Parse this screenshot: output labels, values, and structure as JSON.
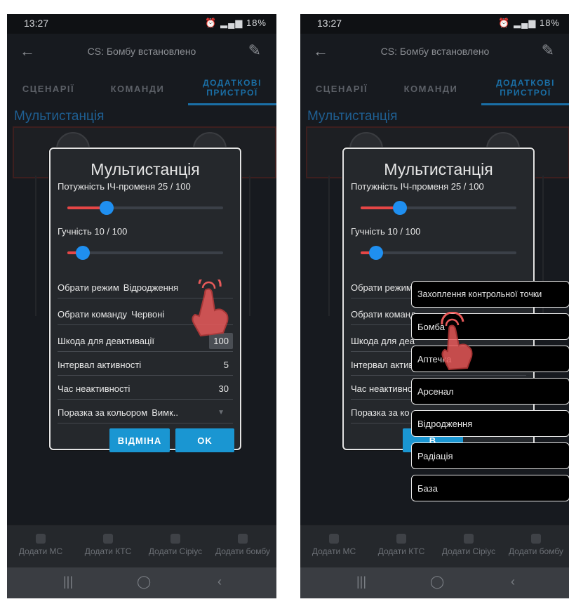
{
  "left": {
    "status": {
      "time": "13:27",
      "battery": "18%"
    },
    "appbar": {
      "title": "CS: Бомбу встановлено"
    },
    "tabs": [
      "СЦЕНАРІЇ",
      "КОМАНДИ",
      "ДОДАТКОВІ ПРИСТРОЇ"
    ],
    "section_title": "Мультистанція",
    "dialog": {
      "title": "Мультистанція",
      "ir_label": "Потужність ІЧ-променя 25 / 100",
      "ir_value": 25,
      "volume_label": "Гучність 10 / 100",
      "volume_value": 10,
      "mode_label": "Обрати режим",
      "mode_value": "Відродження",
      "team_label": "Обрати команду",
      "team_value": "Червоні",
      "damage_label": "Шкода для деактивації",
      "damage_value": "100",
      "interval_label": "Інтервал активності",
      "interval_value": "5",
      "inactive_label": "Час неактивності",
      "inactive_value": "30",
      "color_defeat_label": "Поразка за кольором",
      "color_defeat_value": "Вимк..",
      "cancel": "ВІДМІНА",
      "ok": "OK"
    },
    "bottomnav": [
      "Додати МС",
      "Додати КТС",
      "Додати Сіріус",
      "Додати бомбу"
    ]
  },
  "right": {
    "status": {
      "time": "13:27",
      "battery": "18%"
    },
    "appbar": {
      "title": "CS: Бомбу встановлено"
    },
    "tabs": [
      "СЦЕНАРІЇ",
      "КОМАНДИ",
      "ДОДАТКОВІ ПРИСТРОЇ"
    ],
    "section_title": "Мультистанція",
    "dialog": {
      "title": "Мультистанція",
      "ir_label": "Потужність ІЧ-променя 25 / 100",
      "ir_value": 25,
      "volume_label": "Гучність 10 / 100",
      "volume_value": 10,
      "mode_label": "Обрати режим",
      "team_label": "Обрати команд",
      "damage_label": "Шкода для деа",
      "interval_label": "Інтервал актив",
      "inactive_label": "Час неактивно",
      "color_defeat_label": "Поразка за ко",
      "cancel_partial": "В"
    },
    "dropdown": [
      "Захоплення контрольної точки",
      "Бомба",
      "Аптечка",
      "Арсенал",
      "Відродження",
      "Радіація",
      "База"
    ],
    "bottomnav": [
      "Додати МС",
      "Додати КТС",
      "Додати Сіріус",
      "Додати бомбу"
    ]
  },
  "colors": {
    "accent": "#1a96d2",
    "slider_fill": "#e64646",
    "knob": "#1f8ff0",
    "hand": "#e85a5a"
  }
}
